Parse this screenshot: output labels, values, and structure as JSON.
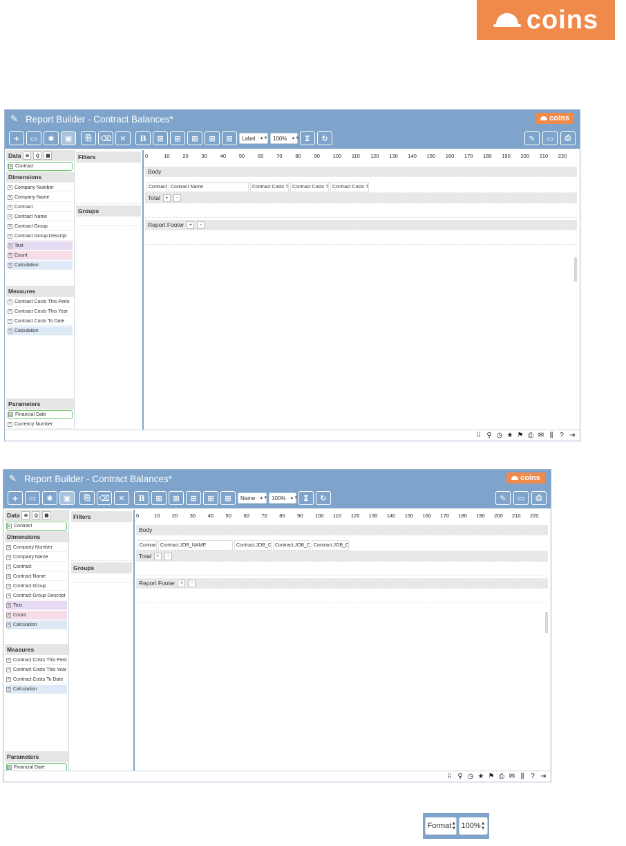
{
  "brand": {
    "name": "coins"
  },
  "window": {
    "title": "Report Builder - Contract Balances*",
    "logo": "coins"
  },
  "toolbar": {
    "buttons": [
      "plus-icon",
      "folder-open-icon",
      "gear-icon",
      "save-icon",
      "export-icon",
      "trash-icon",
      "close-icon",
      "bold-icon",
      "grid-icon-1",
      "grid-icon-2",
      "grid-icon-3",
      "grid-icon-4",
      "grid-icon-5"
    ],
    "bold_label": "B",
    "zoom_value": "100%",
    "right_buttons": [
      "edit-icon",
      "monitor-icon",
      "print-icon"
    ]
  },
  "panel": {
    "data_label": "Data",
    "data_source": "Contract",
    "dimensions_label": "Dimensions",
    "dimensions": [
      "Company Number",
      "Company Name",
      "Contract",
      "Contract Name",
      "Contract Group",
      "Contract Group Descript",
      "Text",
      "Count",
      "Calculation"
    ],
    "measures_label": "Measures",
    "measures": [
      "Contract Costs This Perio",
      "Contract Costs This Year",
      "Contract Costs To Date",
      "Calculation"
    ],
    "parameters_label": "Parameters",
    "parameters": [
      "Financial Date",
      "Currency Number"
    ],
    "filters_label": "Filters",
    "groups_label": "Groups"
  },
  "canvas": {
    "ruler": [
      "0",
      "10",
      "20",
      "30",
      "40",
      "50",
      "60",
      "70",
      "80",
      "90",
      "100",
      "110",
      "120",
      "130",
      "140",
      "150",
      "160",
      "170",
      "180",
      "190",
      "200",
      "210",
      "220"
    ],
    "body_label": "Body",
    "total_label": "Total",
    "footer_label": "Report Footer",
    "plus": "+",
    "minus": "-"
  },
  "shot1": {
    "label_select": "Label",
    "cells": [
      "Contract",
      "Contract Name",
      "Contract Costs Th",
      "Contract Costs Th",
      "Contract Costs To"
    ]
  },
  "shot2": {
    "label_select": "Name",
    "cells": [
      "Contract",
      "Contract.JOB_NAME",
      "Contract.JOB_CO",
      "Contract.JOB_CO",
      "Contract.JOB_CO"
    ]
  },
  "bottom_tools": {
    "format_select": "Format",
    "zoom_select": "100%"
  },
  "colors": {
    "brand_orange": "#f08a4b",
    "toolbar_blue": "#7ea4cb",
    "text_field": "#e7dbf3",
    "count_field": "#f7dde8",
    "calc_field": "#dde9f6",
    "selected_border": "#6cc36c"
  }
}
